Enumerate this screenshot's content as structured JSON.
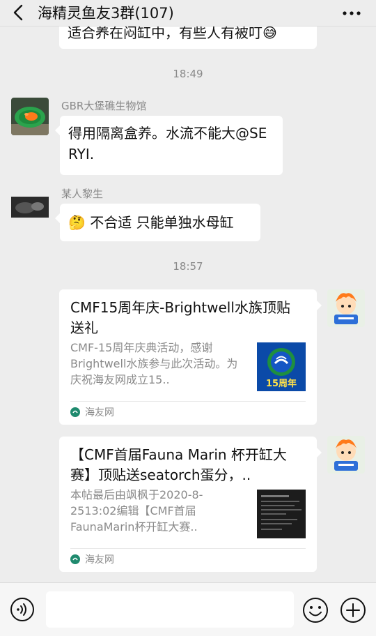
{
  "header": {
    "title": "海精灵鱼友3群(107)"
  },
  "messages": {
    "partial_text": "适合养在闷缸中，有些人有被叮😅",
    "time1": "18:49",
    "msg1": {
      "sender": "GBR大堡礁生物馆",
      "text": "得用隔离盒养。水流不能大@SERYI."
    },
    "msg2": {
      "sender": "某人黎生",
      "emoji": "🤔",
      "text": "不合适 只能单独水母缸"
    },
    "time2": "18:57",
    "card1": {
      "title": "CMF15周年庆-Brightwell水族顶贴送礼",
      "desc": "CMF-15周年庆典活动，感谢Brightwell水族参与此次活动。为庆祝海友网成立15..",
      "thumb_text": "15周年",
      "source": "海友网"
    },
    "card2": {
      "title": "【CMF首届Fauna Marin 杯开缸大赛】顶贴送seatorch蛋分，..",
      "desc": "本帖最后由飒枫于2020-8-2513:02编辑【CMF首届FaunaMarin杯开缸大赛..",
      "source": "海友网"
    }
  },
  "colors": {
    "background": "#ededed",
    "bubble": "#ffffff",
    "meta_text": "#8a8a8a"
  }
}
